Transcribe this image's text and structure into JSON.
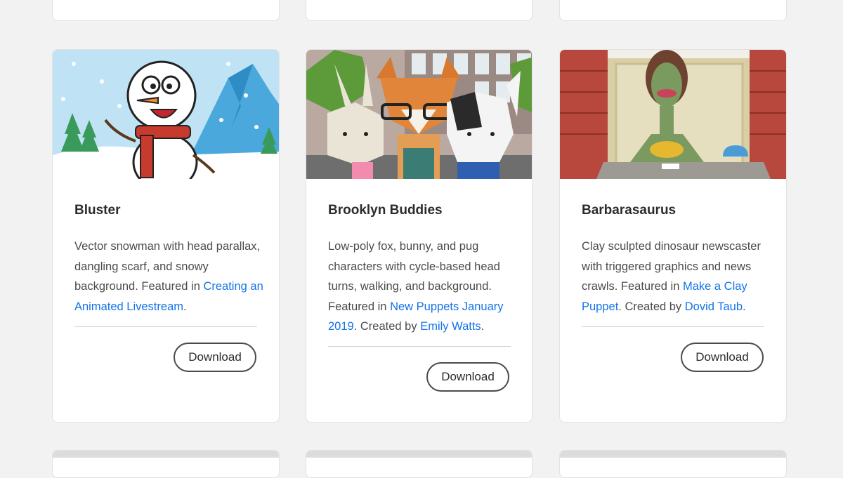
{
  "download_label": "Download",
  "cards": [
    {
      "title": "Bluster",
      "desc": [
        {
          "t": "Vector snowman with head parallax, dangling scarf, and snowy background. Featured in "
        },
        {
          "t": "Creating an Animated Livestream",
          "link": true
        },
        {
          "t": "."
        }
      ],
      "thumb": "snowman-thumbnail"
    },
    {
      "title": "Brooklyn Buddies",
      "desc": [
        {
          "t": "Low-poly fox, bunny, and pug characters with cycle-based head turns, walking, and background. Featured in "
        },
        {
          "t": "New Puppets January 2019",
          "link": true
        },
        {
          "t": ". Created by "
        },
        {
          "t": "Emily Watts",
          "link": true
        },
        {
          "t": "."
        }
      ],
      "thumb": "lowpoly-animals-thumbnail"
    },
    {
      "title": "Barbarasaurus",
      "desc": [
        {
          "t": "Clay sculpted dinosaur newscaster with triggered graphics and news crawls. Featured in "
        },
        {
          "t": "Make a Clay Puppet",
          "link": true
        },
        {
          "t": ". Created by "
        },
        {
          "t": "Dovid Taub",
          "link": true
        },
        {
          "t": "."
        }
      ],
      "thumb": "clay-dinosaur-thumbnail"
    }
  ],
  "colors": {
    "link": "#1473e6",
    "title": "#2c2c2c",
    "body": "#4b4b4b",
    "page_bg": "#f2f2f2"
  }
}
